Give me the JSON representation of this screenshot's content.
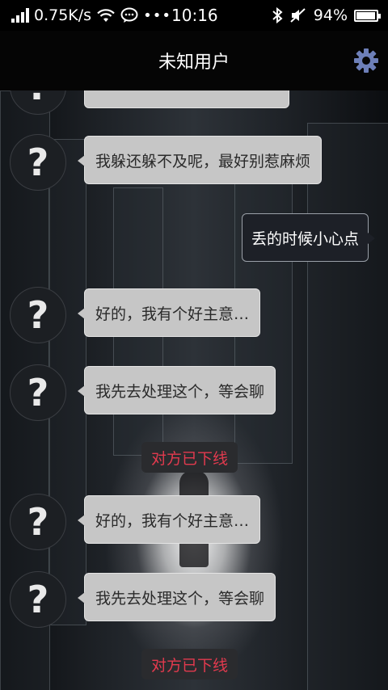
{
  "status_bar": {
    "speed": "0.75K/s",
    "time": "10:16",
    "battery": "94%",
    "battery_level": 0.94,
    "icons": [
      "signal-icon",
      "wifi-icon",
      "chat-notification-icon",
      "more-icon",
      "bluetooth-icon",
      "mute-icon",
      "battery-icon"
    ]
  },
  "header": {
    "title": "未知用户",
    "settings_icon": "gear-icon",
    "accent_color": "#6d7fb8"
  },
  "avatar_glyph": "?",
  "messages": [
    {
      "side": "in",
      "text": ""
    },
    {
      "side": "in",
      "text": "我躲还躲不及呢，最好别惹麻烦"
    },
    {
      "side": "out",
      "text": "丢的时候小心点"
    },
    {
      "side": "in",
      "text": "好的，我有个好主意…"
    },
    {
      "side": "in",
      "text": "我先去处理这个，等会聊"
    },
    {
      "side": "system",
      "text": "对方已下线"
    },
    {
      "side": "in",
      "text": "好的，我有个好主意…"
    },
    {
      "side": "in",
      "text": "我先去处理这个，等会聊"
    },
    {
      "side": "system",
      "text": "对方已下线"
    }
  ],
  "colors": {
    "system_text": "#e23a4e",
    "incoming_bubble": "#c6c6c6",
    "outgoing_bubble": "#1d2027"
  }
}
